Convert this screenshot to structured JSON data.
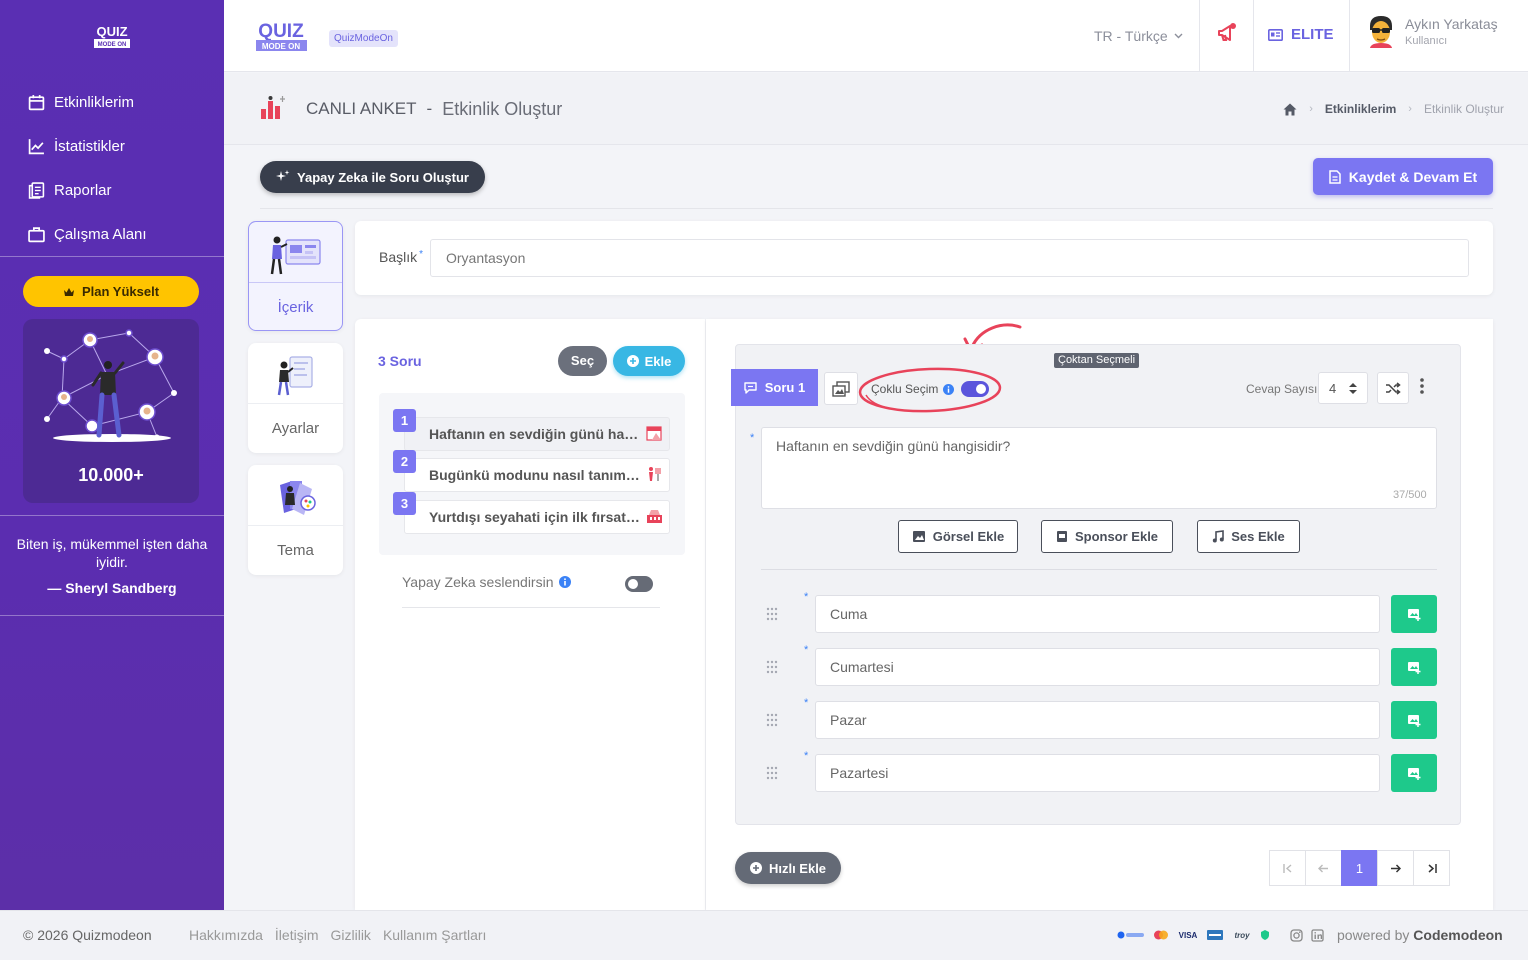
{
  "app": {
    "logo_top": "QUIZ",
    "logo_bottom": "MODE ON",
    "badge": "QuizModeOn"
  },
  "colors": {
    "sidebar": "#5a2fb3",
    "primary": "#7b76f2",
    "accent_yellow": "#ffc400",
    "success": "#1ec98b",
    "info": "#38b7e4",
    "dark": "#383e4c"
  },
  "sidebar": {
    "items": [
      {
        "label": "Etkinliklerim",
        "icon": "calendar-icon"
      },
      {
        "label": "İstatistikler",
        "icon": "chart-line-icon"
      },
      {
        "label": "Raporlar",
        "icon": "report-icon"
      },
      {
        "label": "Çalışma Alanı",
        "icon": "briefcase-icon"
      }
    ],
    "plan_button": "Plan Yükselt",
    "promo_count": "10.000+",
    "quote": "Biten iş, mükemmel işten daha iyidir.",
    "quote_author": "— Sheryl Sandberg"
  },
  "topbar": {
    "language": "TR - Türkçe",
    "plan": "ELITE",
    "user_name": "Aykın Yarkataş",
    "user_role": "Kullanıcı"
  },
  "page": {
    "category": "CANLI ANKET",
    "separator": "-",
    "title": "Etkinlik Oluştur",
    "breadcrumb": [
      "Etkinliklerim",
      "Etkinlik Oluştur"
    ]
  },
  "actions": {
    "ai_button": "Yapay Zeka ile Soru Oluştur",
    "save_button": "Kaydet & Devam Et"
  },
  "tabs": [
    {
      "label": "İçerik",
      "active": true
    },
    {
      "label": "Ayarlar",
      "active": false
    },
    {
      "label": "Tema",
      "active": false
    }
  ],
  "title_field": {
    "label": "Başlık",
    "required": "*",
    "value": "Oryantasyon"
  },
  "questions": {
    "count_label": "3 Soru",
    "select_button": "Seç",
    "add_button": "Ekle",
    "items": [
      {
        "num": "1",
        "text": "Haftanın en sevdiğin günü hangisidir?"
      },
      {
        "num": "2",
        "text": "Bugünkü modunu nasıl tanımlarsın?"
      },
      {
        "num": "3",
        "text": "Yurtdışı seyahati için ilk fırsatta nereye gitmek istersin?"
      }
    ],
    "ai_voice_label": "Yapay Zeka seslendirsin",
    "ai_voice_enabled": false
  },
  "editor": {
    "question_tag": "Soru 1",
    "multi_select_label": "Çoklu Seçim",
    "multi_select_enabled": true,
    "type_badge": "Çoktan Seçmeli",
    "answer_count_label": "Cevap Sayısı",
    "answer_count": "4",
    "question_text": "Haftanın en sevdiğin günü hangisidir?",
    "char_counter": "37/500",
    "media_buttons": [
      "Görsel Ekle",
      "Sponsor Ekle",
      "Ses Ekle"
    ],
    "required_mark": "*",
    "answers": [
      "Cuma",
      "Cumartesi",
      "Pazar",
      "Pazartesi"
    ],
    "quick_add": "Hızlı Ekle",
    "pagination": {
      "current": "1"
    }
  },
  "footer": {
    "copyright": "© 2026 Quizmodeon",
    "links": [
      "Hakkımızda",
      "İletişim",
      "Gizlilik",
      "Kullanım Şartları"
    ],
    "powered_prefix": "powered by",
    "powered_brand": "Codemodeon"
  }
}
